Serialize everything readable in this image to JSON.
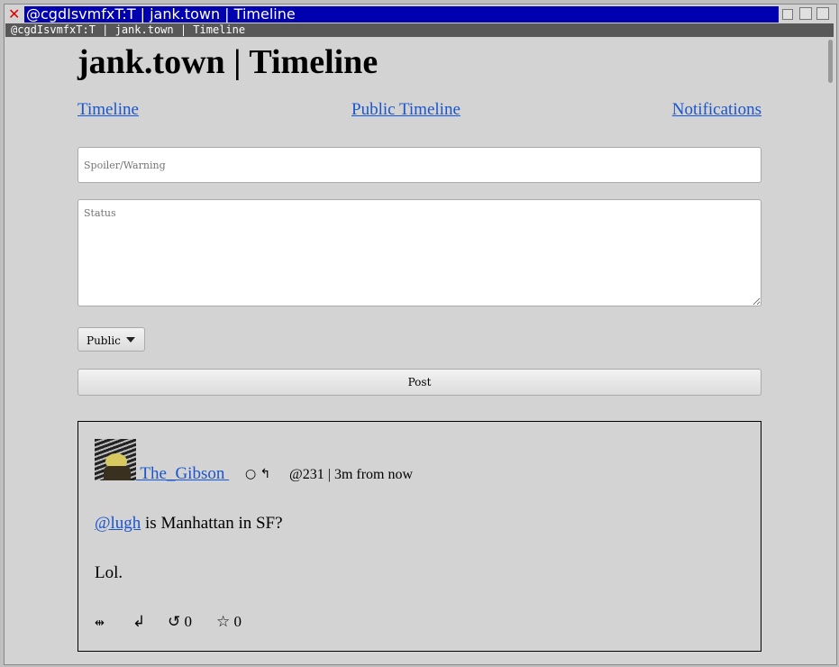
{
  "window": {
    "title": "@cgdIsvmfxT:T | jank.town | Timeline",
    "tab_title": "@cgdIsvmfxT:T | jank.town | Timeline"
  },
  "page": {
    "heading": "jank.town | Timeline"
  },
  "nav": {
    "timeline": "Timeline",
    "public_timeline": "Public Timeline",
    "notifications": "Notifications"
  },
  "compose": {
    "spoiler_placeholder": "Spoiler/Warning",
    "status_placeholder": "Status",
    "visibility": "Public",
    "post_label": "Post"
  },
  "statuses": [
    {
      "username": " The_Gibson ",
      "indicator_icons": "○ ↰",
      "meta": "@231 | 3m from now",
      "mention": "@lugh",
      "text1": " is Manhattan in SF?",
      "text2": "Lol.",
      "actions": {
        "thread": "⇹",
        "reply": "↲",
        "boost": "↺ 0",
        "favourite": "☆ 0"
      }
    }
  ]
}
